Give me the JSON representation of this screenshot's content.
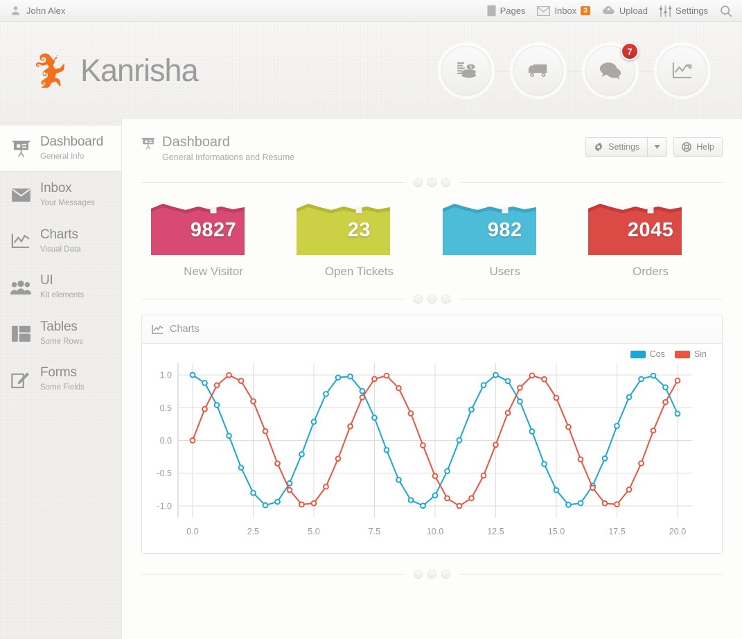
{
  "topbar": {
    "user": "John Alex",
    "user_icon": "user-icon",
    "items": [
      {
        "label": "Pages",
        "icon": "page-icon"
      },
      {
        "label": "Inbox",
        "icon": "envelope-icon",
        "badge": "3"
      },
      {
        "label": "Upload",
        "icon": "cloud-upload-icon"
      },
      {
        "label": "Settings",
        "icon": "sliders-icon"
      }
    ],
    "search_icon": "search-icon"
  },
  "header": {
    "logo_text": "Kanrisha",
    "logo_icon": "lizard-logo-icon",
    "circles": [
      {
        "icon": "coins-money-icon",
        "badge": ""
      },
      {
        "icon": "delivery-truck-icon",
        "badge": ""
      },
      {
        "icon": "chat-bubbles-icon",
        "badge": "7"
      },
      {
        "icon": "line-chart-icon",
        "badge": ""
      }
    ]
  },
  "sidebar": {
    "items": [
      {
        "title": "Dashboard",
        "sub": "General Info",
        "icon": "presentation-icon",
        "active": true
      },
      {
        "title": "Inbox",
        "sub": "Your Messages",
        "icon": "envelope-icon",
        "active": false
      },
      {
        "title": "Charts",
        "sub": "Visual Data",
        "icon": "line-chart-icon",
        "active": false
      },
      {
        "title": "UI",
        "sub": "Kit elements",
        "icon": "users-group-icon",
        "active": false
      },
      {
        "title": "Tables",
        "sub": "Some Rows",
        "icon": "table-layout-icon",
        "active": false
      },
      {
        "title": "Forms",
        "sub": "Some Fields",
        "icon": "pencil-square-icon",
        "active": false
      }
    ]
  },
  "page": {
    "title": "Dashboard",
    "subtitle": "General Informations and Resume",
    "icon": "presentation-icon",
    "settings_label": "Settings",
    "settings_icon": "gear-icon",
    "caret_icon": "chevron-down-icon",
    "help_label": "Help",
    "help_icon": "lifebuoy-icon"
  },
  "stats": [
    {
      "value": "9827",
      "label": "New Visitor",
      "color": "#d84a72"
    },
    {
      "value": "23",
      "label": "Open Tickets",
      "color": "#ccd044"
    },
    {
      "value": "982",
      "label": "Users",
      "color": "#4cbcd8"
    },
    {
      "value": "2045",
      "label": "Orders",
      "color": "#dc4a46"
    }
  ],
  "charts_panel": {
    "title": "Charts",
    "icon": "line-chart-icon"
  },
  "chart_data": {
    "type": "line",
    "title": "Charts",
    "xlabel": "",
    "ylabel": "",
    "xlim": [
      -0.6,
      20.6
    ],
    "ylim": [
      -1.18,
      1.18
    ],
    "xticks": [
      "0.0",
      "2.5",
      "5.0",
      "7.5",
      "10.0",
      "12.5",
      "15.0",
      "17.5",
      "20.0"
    ],
    "yticks": [
      "1.0",
      "0.5",
      "0.0",
      "-0.5",
      "-1.0"
    ],
    "grid": true,
    "legend_position": "top-right",
    "markers": "circle-open",
    "x": [
      0,
      0.5,
      1,
      1.5,
      2,
      2.5,
      3,
      3.5,
      4,
      4.5,
      5,
      5.5,
      6,
      6.5,
      7,
      7.5,
      8,
      8.5,
      9,
      9.5,
      10,
      10.5,
      11,
      11.5,
      12,
      12.5,
      13,
      13.5,
      14,
      14.5,
      15,
      15.5,
      16,
      16.5,
      17,
      17.5,
      18,
      18.5,
      19,
      19.5,
      20
    ],
    "series": [
      {
        "name": "Cos",
        "color": "#17a8d8",
        "values": [
          1.0,
          0.878,
          0.54,
          0.071,
          -0.416,
          -0.801,
          -0.99,
          -0.936,
          -0.654,
          -0.211,
          0.284,
          0.709,
          0.96,
          0.977,
          0.754,
          0.347,
          -0.146,
          -0.602,
          -0.911,
          -0.997,
          -0.839,
          -0.469,
          0.004,
          0.471,
          0.844,
          0.999,
          0.907,
          0.595,
          0.137,
          -0.36,
          -0.76,
          -0.983,
          -0.958,
          -0.69,
          -0.275,
          0.221,
          0.661,
          0.937,
          0.989,
          0.811,
          0.408
        ]
      },
      {
        "name": "Sin",
        "color": "#f0533d",
        "values": [
          0.0,
          0.479,
          0.841,
          0.997,
          0.909,
          0.598,
          0.141,
          -0.351,
          -0.757,
          -0.978,
          -0.959,
          -0.706,
          -0.279,
          0.215,
          0.657,
          0.938,
          0.989,
          0.798,
          0.412,
          -0.075,
          -0.544,
          -0.883,
          -1.0,
          -0.882,
          -0.537,
          -0.066,
          0.42,
          0.804,
          0.991,
          0.935,
          0.65,
          0.206,
          -0.288,
          -0.724,
          -0.961,
          -0.975,
          -0.751,
          -0.35,
          0.15,
          0.585,
          0.913
        ]
      }
    ]
  }
}
